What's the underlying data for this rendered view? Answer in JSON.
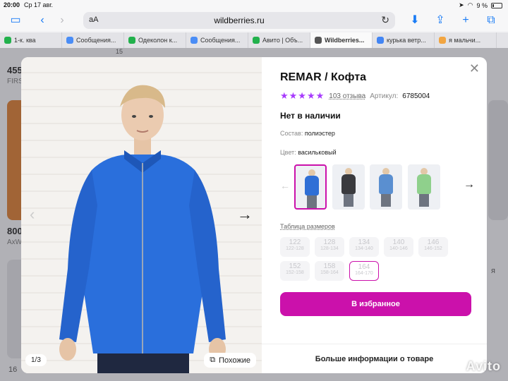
{
  "status": {
    "time": "20:00",
    "date": "Ср 17 авг.",
    "battery": "9 %"
  },
  "toolbar": {
    "aa": "аА",
    "url": "wildberries.ru"
  },
  "tabs": [
    {
      "label": "1-к. ква",
      "color": "#22b14c"
    },
    {
      "label": "Сообщения...",
      "color": "#4a8df6"
    },
    {
      "label": "Одеколон к...",
      "color": "#22b14c"
    },
    {
      "label": "Сообщения...",
      "color": "#4a8df6"
    },
    {
      "label": "Авито | Объ...",
      "color": "#22b14c"
    },
    {
      "label": "Wildberries...",
      "color": "#555555"
    },
    {
      "label": "курька ветр...",
      "color": "#4285f4"
    },
    {
      "label": "я мальчи...",
      "color": "#f2a541"
    }
  ],
  "background": {
    "num1": "455",
    "num1_sub": "FIRS",
    "num2": "800",
    "num2_sub": "AxW",
    "num3": "16",
    "num4": "15",
    "right_text": "я"
  },
  "product": {
    "title": "REMAR / Кофта",
    "stars": "★★★★★",
    "reviews": "103 отзыва",
    "article_label": "Артикул:",
    "article": "6785004",
    "availability": "Нет в наличии",
    "composition_label": "Состав:",
    "composition": "полиэстер",
    "color_label": "Цвет:",
    "color": "васильковый",
    "size_table": "Таблица размеров",
    "sizes": [
      {
        "n": "122",
        "r": "122-128"
      },
      {
        "n": "128",
        "r": "128-134"
      },
      {
        "n": "134",
        "r": "134-140"
      },
      {
        "n": "140",
        "r": "140-146"
      },
      {
        "n": "146",
        "r": "146-152"
      },
      {
        "n": "152",
        "r": "152-158"
      },
      {
        "n": "158",
        "r": "158-164"
      },
      {
        "n": "164",
        "r": "164-170"
      }
    ],
    "favorite_button": "В избранное",
    "more_info": "Больше информации о товаре"
  },
  "photo": {
    "counter": "1/3",
    "similar": "Похожие"
  },
  "swatch_colors": [
    "#2f6fd6",
    "#3a3a3e",
    "#5a8fd0",
    "#8fd08c"
  ],
  "accent": "#cb11ab",
  "watermark": "Avito"
}
